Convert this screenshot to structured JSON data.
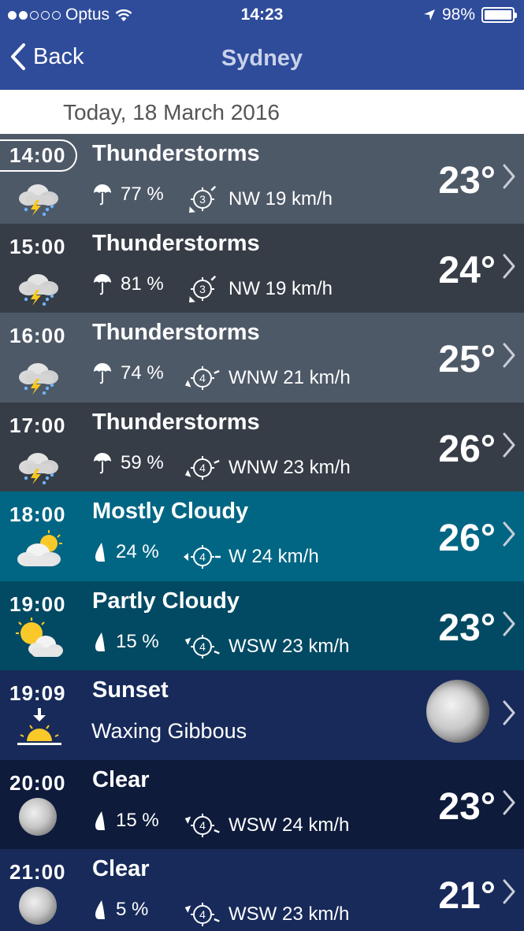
{
  "status_bar": {
    "carrier": "Optus",
    "time": "14:23",
    "battery": "98%"
  },
  "nav": {
    "back_label": "Back",
    "title": "Sydney"
  },
  "date_header": "Today, 18 March 2016",
  "rows": [
    {
      "time": "14:00",
      "condition": "Thunderstorms",
      "icon": "thunderstorm-icon",
      "rain": "77 %",
      "wind": "NW 19 km/h",
      "wind_force": "3",
      "temp": "23°",
      "bg": "#4e5968",
      "current": true
    },
    {
      "time": "15:00",
      "condition": "Thunderstorms",
      "icon": "thunderstorm-icon",
      "rain": "81 %",
      "wind": "NW 19 km/h",
      "wind_force": "3",
      "temp": "24°",
      "bg": "#363d47"
    },
    {
      "time": "16:00",
      "condition": "Thunderstorms",
      "icon": "thunderstorm-icon",
      "rain": "74 %",
      "wind": "WNW 21 km/h",
      "wind_force": "4",
      "temp": "25°",
      "bg": "#4e5968"
    },
    {
      "time": "17:00",
      "condition": "Thunderstorms",
      "icon": "thunderstorm-icon",
      "rain": "59 %",
      "wind": "WNW 23 km/h",
      "wind_force": "4",
      "temp": "26°",
      "bg": "#363d47"
    },
    {
      "time": "18:00",
      "condition": "Mostly Cloudy",
      "icon": "mostly-cloudy-icon",
      "rain": "24 %",
      "wind": "W 24 km/h",
      "wind_force": "4",
      "temp": "26°",
      "bg": "#006684"
    },
    {
      "time": "19:00",
      "condition": "Partly Cloudy",
      "icon": "partly-cloudy-icon",
      "rain": "15 %",
      "wind": "WSW 23 km/h",
      "wind_force": "4",
      "temp": "23°",
      "bg": "#024a63"
    },
    {
      "time": "19:09",
      "condition": "Sunset",
      "icon": "sunset-icon",
      "subtitle": "Waxing Gibbous",
      "bg": "#172a5a",
      "moon": true
    },
    {
      "time": "20:00",
      "condition": "Clear",
      "icon": "moon-icon",
      "rain": "15 %",
      "wind": "WSW 24 km/h",
      "wind_force": "4",
      "temp": "23°",
      "bg": "#0e1b3b"
    },
    {
      "time": "21:00",
      "condition": "Clear",
      "icon": "moon-icon",
      "rain": "5 %",
      "wind": "WSW 23 km/h",
      "wind_force": "4",
      "temp": "21°",
      "bg": "#172a5a"
    }
  ]
}
